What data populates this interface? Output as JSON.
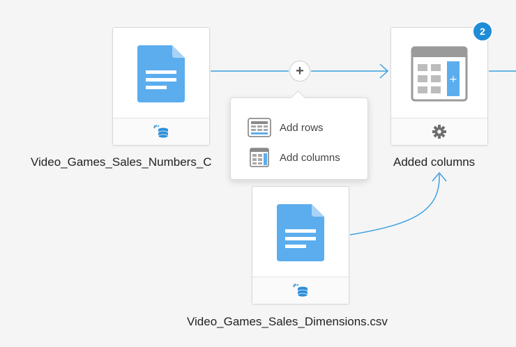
{
  "nodes": {
    "numbers_dataset": {
      "label": "Video_Games_Sales_Numbers_C",
      "icon": "document-icon",
      "footer_icon": "dataset-icon"
    },
    "dimensions_dataset": {
      "label": "Video_Games_Sales_Dimensions.csv",
      "icon": "document-icon",
      "footer_icon": "dataset-icon"
    },
    "added_columns": {
      "label": "Added columns",
      "icon": "table-add-column-icon",
      "footer_icon": "gear-icon",
      "badge": "2"
    }
  },
  "connector": {
    "plus_label": "+"
  },
  "menu": {
    "items": [
      {
        "label": "Add rows",
        "icon": "add-rows-icon"
      },
      {
        "label": "Add columns",
        "icon": "add-columns-icon"
      }
    ]
  },
  "colors": {
    "accent": "#1f8dd6",
    "connector": "#3aa0e0",
    "document": "#5badee",
    "icon_gray": "#8a8a8a",
    "background": "#f5f5f5"
  }
}
